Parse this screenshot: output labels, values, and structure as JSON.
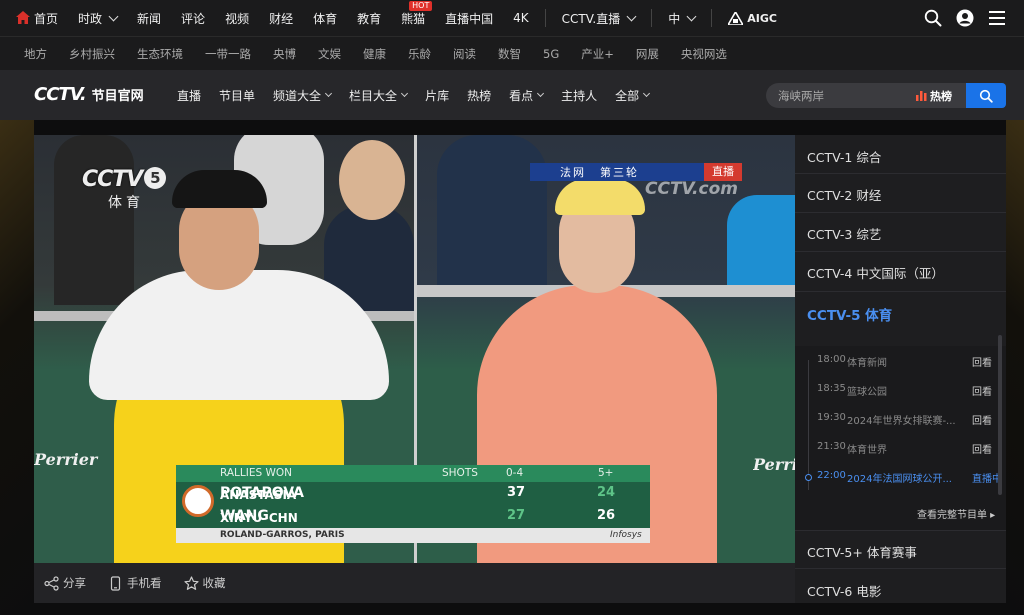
{
  "topnav": {
    "items": [
      "首页",
      "时政",
      "新闻",
      "评论",
      "视频",
      "财经",
      "体育",
      "教育",
      "熊猫",
      "直播中国",
      "4K",
      "CCTV.直播",
      "中",
      "AIGC"
    ],
    "hot_badge": "HOT"
  },
  "subnav": {
    "items": [
      "地方",
      "乡村振兴",
      "生态环境",
      "一带一路",
      "央博",
      "文娱",
      "健康",
      "乐龄",
      "阅读",
      "数智",
      "5G",
      "产业+",
      "网展",
      "央视网选"
    ]
  },
  "header": {
    "logo": "CCTV.",
    "logo_sub": "节目官网",
    "nav": [
      "直播",
      "节目单",
      "频道大全",
      "栏目大全",
      "片库",
      "热榜",
      "看点",
      "主持人",
      "全部"
    ],
    "search_placeholder": "海峡两岸",
    "hot_label": "热榜"
  },
  "player": {
    "channel_logo": "CCTV",
    "channel_number": "5",
    "channel_sub": "体育",
    "live_tag": {
      "tour": "法网",
      "round": "第三轮",
      "live": "直播"
    },
    "watermark": "CCTV.com",
    "scoreboard": {
      "header": "RALLIES WON",
      "col_shots": "SHOTS",
      "col_a": "0-4",
      "col_b": "5+",
      "rows": [
        {
          "first": "ANASTASIA",
          "last": "POTAPOVA",
          "country": "",
          "a": "37",
          "b": "24"
        },
        {
          "first": "XINYU",
          "last": "WANG",
          "country": "CHN",
          "a": "27",
          "b": "26"
        }
      ],
      "footer": "ROLAND-GARROS, PARIS",
      "sponsor": "Infosys",
      "court_ads": [
        "Perrier",
        "Perrier"
      ]
    }
  },
  "toolbar": {
    "items": [
      "分享",
      "手机看",
      "收藏"
    ]
  },
  "channels": {
    "top": [
      "CCTV-1 综合",
      "CCTV-2 财经",
      "CCTV-3 综艺",
      "CCTV-4 中文国际（亚）",
      "CCTV-5 体育"
    ],
    "bottom": [
      "CCTV-5+ 体育赛事",
      "CCTV-6 电影"
    ],
    "schedule": [
      {
        "time": "18:00",
        "name": "体育新闻",
        "action": "回看"
      },
      {
        "time": "18:35",
        "name": "篮球公园",
        "action": "回看"
      },
      {
        "time": "19:30",
        "name": "2024年世界女排联赛-...",
        "action": "回看"
      },
      {
        "time": "21:30",
        "name": "体育世界",
        "action": "回看"
      },
      {
        "time": "22:00",
        "name": "2024年法国网球公开...",
        "action": "直播中"
      }
    ],
    "full_schedule": "查看完整节目单"
  },
  "colors": {
    "accent": "#1a73e8",
    "active": "#4a8ff0",
    "home": "#d9302a",
    "court": "#2f5d4a"
  }
}
